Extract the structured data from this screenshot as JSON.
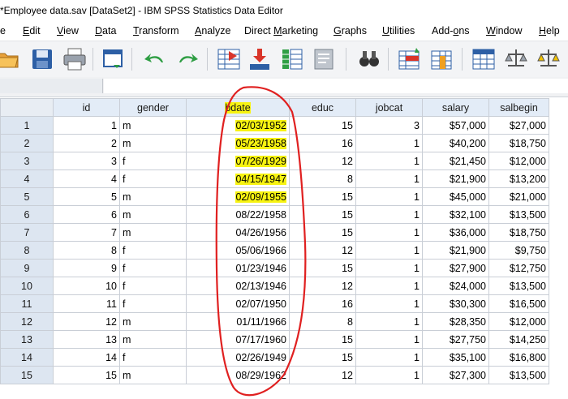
{
  "window": {
    "title": "*Employee data.sav [DataSet2] - IBM SPSS Statistics Data Editor"
  },
  "menu": [
    {
      "label": "e",
      "mnemonic": ""
    },
    {
      "label": "Edit",
      "mnemonic": "E"
    },
    {
      "label": "View",
      "mnemonic": "V"
    },
    {
      "label": "Data",
      "mnemonic": "D"
    },
    {
      "label": "Transform",
      "mnemonic": "T"
    },
    {
      "label": "Analyze",
      "mnemonic": "A"
    },
    {
      "label": "Direct Marketing",
      "mnemonic": "M"
    },
    {
      "label": "Graphs",
      "mnemonic": "G"
    },
    {
      "label": "Utilities",
      "mnemonic": "U"
    },
    {
      "label": "Add-ons",
      "mnemonic": "o"
    },
    {
      "label": "Window",
      "mnemonic": "W"
    },
    {
      "label": "Help",
      "mnemonic": "H"
    }
  ],
  "toolbar": [
    {
      "icon": "open-folder-icon"
    },
    {
      "icon": "save-icon"
    },
    {
      "icon": "print-icon"
    },
    {
      "icon": "recall-dialog-icon"
    },
    {
      "icon": "undo-icon"
    },
    {
      "icon": "redo-icon"
    },
    {
      "icon": "go-to-case-icon"
    },
    {
      "icon": "go-to-variable-icon"
    },
    {
      "icon": "variables-icon"
    },
    {
      "icon": "run-descriptives-icon"
    },
    {
      "icon": "find-icon"
    },
    {
      "icon": "insert-cases-icon"
    },
    {
      "icon": "insert-variable-icon"
    },
    {
      "icon": "split-file-icon"
    },
    {
      "icon": "weight-cases-icon"
    },
    {
      "icon": "select-cases-icon"
    }
  ],
  "grid": {
    "columns": [
      "id",
      "gender",
      "bdate",
      "educ",
      "jobcat",
      "salary",
      "salbegin"
    ],
    "rows": [
      [
        "1",
        "1",
        "m",
        "02/03/1952",
        "15",
        "3",
        "$57,000",
        "$27,000"
      ],
      [
        "2",
        "2",
        "m",
        "05/23/1958",
        "16",
        "1",
        "$40,200",
        "$18,750"
      ],
      [
        "3",
        "3",
        "f",
        "07/26/1929",
        "12",
        "1",
        "$21,450",
        "$12,000"
      ],
      [
        "4",
        "4",
        "f",
        "04/15/1947",
        "8",
        "1",
        "$21,900",
        "$13,200"
      ],
      [
        "5",
        "5",
        "m",
        "02/09/1955",
        "15",
        "1",
        "$45,000",
        "$21,000"
      ],
      [
        "6",
        "6",
        "m",
        "08/22/1958",
        "15",
        "1",
        "$32,100",
        "$13,500"
      ],
      [
        "7",
        "7",
        "m",
        "04/26/1956",
        "15",
        "1",
        "$36,000",
        "$18,750"
      ],
      [
        "8",
        "8",
        "f",
        "05/06/1966",
        "12",
        "1",
        "$21,900",
        "$9,750"
      ],
      [
        "9",
        "9",
        "f",
        "01/23/1946",
        "15",
        "1",
        "$27,900",
        "$12,750"
      ],
      [
        "10",
        "10",
        "f",
        "02/13/1946",
        "12",
        "1",
        "$24,000",
        "$13,500"
      ],
      [
        "11",
        "11",
        "f",
        "02/07/1950",
        "16",
        "1",
        "$30,300",
        "$16,500"
      ],
      [
        "12",
        "12",
        "m",
        "01/11/1966",
        "8",
        "1",
        "$28,350",
        "$12,000"
      ],
      [
        "13",
        "13",
        "m",
        "07/17/1960",
        "15",
        "1",
        "$27,750",
        "$14,250"
      ],
      [
        "14",
        "14",
        "f",
        "02/26/1949",
        "15",
        "1",
        "$35,100",
        "$16,800"
      ],
      [
        "15",
        "15",
        "m",
        "08/29/1962",
        "12",
        "1",
        "$27,300",
        "$13,500"
      ]
    ],
    "highlighted_bdate_rows": [
      1,
      2,
      3,
      4,
      5
    ],
    "highlight_color": "#f7f312",
    "annotation_color": "#e02020"
  }
}
